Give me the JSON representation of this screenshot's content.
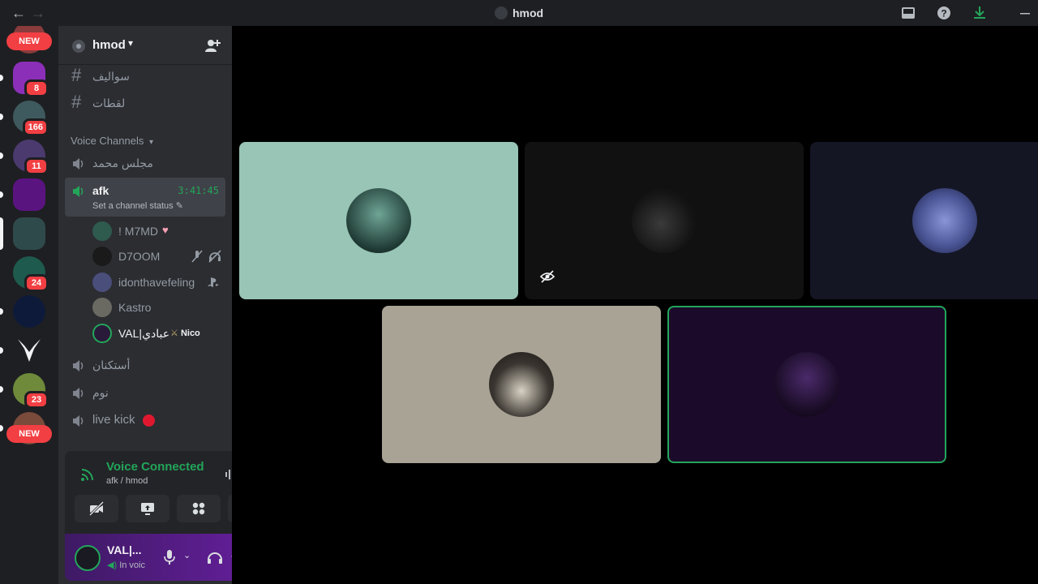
{
  "window": {
    "title": "hmod",
    "back_icon": "arrow-left-icon",
    "forward_icon": "arrow-right-icon"
  },
  "server_rail": {
    "new_label_top": "NEW",
    "new_label_bottom": "NEW",
    "badges": [
      "8",
      "166",
      "11",
      "24",
      "23"
    ]
  },
  "sidebar": {
    "guild_name": "hmod",
    "text_channels": [
      "سواليف",
      "لقطات"
    ],
    "voice_category": "Voice Channels",
    "voice_channels": {
      "first": "مجلس محمد",
      "active": "afk",
      "active_timer": "3:41:45",
      "active_status_prompt": "Set a channel status",
      "after": [
        "أستكنان",
        "نوم",
        "live kick"
      ]
    },
    "voice_users": [
      {
        "name": "! M7MD"
      },
      {
        "name": "D7OOM"
      },
      {
        "name": "idonthavefeling"
      },
      {
        "name": "Kastro"
      },
      {
        "name": "VAL|عبادي",
        "tag": "Nico"
      }
    ]
  },
  "voice_panel": {
    "title": "Voice Connected",
    "subtitle": "afk / hmod"
  },
  "user_panel": {
    "name": "VAL|...",
    "status": "In voic"
  },
  "colors": {
    "accent_green": "#23a55a",
    "danger_red": "#f23f43",
    "tile1_bg": "#98c5b5",
    "tile2_bg": "#111111",
    "tile3_bg": "#141624",
    "tile4_bg": "#a8a395",
    "tile5_bg": "#1c0a2a"
  }
}
